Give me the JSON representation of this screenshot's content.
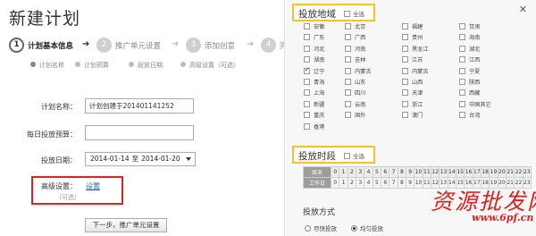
{
  "page_title": "新建计划",
  "steps": [
    {
      "num": "1",
      "label": "计划基本信息"
    },
    {
      "num": "2",
      "label": "推广单元设置"
    },
    {
      "num": "3",
      "label": "添加创意"
    },
    {
      "num": "4",
      "label": "完成"
    }
  ],
  "substeps": [
    "计划名称",
    "计划预算",
    "投放日期",
    "高级设置（可选）"
  ],
  "form": {
    "name_label": "计划名称：",
    "name_value": "计划创建于201401141252",
    "budget_label": "每日投放预算：",
    "budget_value": "",
    "date_label": "投放日期：",
    "date_start": "2014-01-14",
    "date_sep": "至",
    "date_end": "2014-01-20",
    "adv_label": "高级设置：",
    "adv_optional": "（可选）",
    "adv_link": "设置",
    "next_button": "下一步，推广单元设置"
  },
  "region_section": {
    "title": "投放地域",
    "select_all": "全选",
    "regions": [
      {
        "name": "安徽",
        "checked": false
      },
      {
        "name": "北京",
        "checked": false
      },
      {
        "name": "福建",
        "checked": false
      },
      {
        "name": "甘肃",
        "checked": false
      },
      {
        "name": "广东",
        "checked": false
      },
      {
        "name": "广西",
        "checked": false
      },
      {
        "name": "贵州",
        "checked": false
      },
      {
        "name": "海南",
        "checked": false
      },
      {
        "name": "河北",
        "checked": false
      },
      {
        "name": "河南",
        "checked": false
      },
      {
        "name": "黑龙江",
        "checked": false
      },
      {
        "name": "湖北",
        "checked": false
      },
      {
        "name": "湖南",
        "checked": false
      },
      {
        "name": "吉林",
        "checked": false
      },
      {
        "name": "江苏",
        "checked": false
      },
      {
        "name": "江西",
        "checked": false
      },
      {
        "name": "辽宁",
        "checked": true
      },
      {
        "name": "内蒙古",
        "checked": false
      },
      {
        "name": "内蒙古",
        "checked": false
      },
      {
        "name": "宁夏",
        "checked": false
      },
      {
        "name": "青海",
        "checked": false
      },
      {
        "name": "山东",
        "checked": false
      },
      {
        "name": "山西",
        "checked": false
      },
      {
        "name": "陕西",
        "checked": false
      },
      {
        "name": "上海",
        "checked": false
      },
      {
        "name": "四川",
        "checked": false
      },
      {
        "name": "天津",
        "checked": false
      },
      {
        "name": "西藏",
        "checked": false
      },
      {
        "name": "新疆",
        "checked": false
      },
      {
        "name": "云南",
        "checked": false
      },
      {
        "name": "浙江",
        "checked": false
      },
      {
        "name": "中国其它",
        "checked": false
      },
      {
        "name": "重庆",
        "checked": false
      },
      {
        "name": "国外",
        "checked": false
      },
      {
        "name": "澳门",
        "checked": false
      },
      {
        "name": "台湾",
        "checked": false
      },
      {
        "name": "香港",
        "checked": false
      }
    ]
  },
  "time_section": {
    "title": "投放时段",
    "select_all": "全选",
    "rows": [
      "周末",
      "工作日"
    ],
    "hours": [
      "0",
      "1",
      "2",
      "3",
      "4",
      "5",
      "6",
      "7",
      "8",
      "9",
      "10",
      "11",
      "12",
      "13",
      "14",
      "15",
      "16",
      "17",
      "18",
      "19",
      "20",
      "21",
      "22",
      "23"
    ]
  },
  "mode_section": {
    "title": "投放方式",
    "options": [
      {
        "label": "尽快投放",
        "selected": false
      },
      {
        "label": "均匀投放",
        "selected": true
      }
    ]
  },
  "watermark": {
    "cn": "资源批发网",
    "url": "www.6pf.cn"
  },
  "colors": {
    "highlight_red": "#e02020",
    "highlight_yellow": "#f1c232",
    "link_blue": "#2a5db0"
  }
}
